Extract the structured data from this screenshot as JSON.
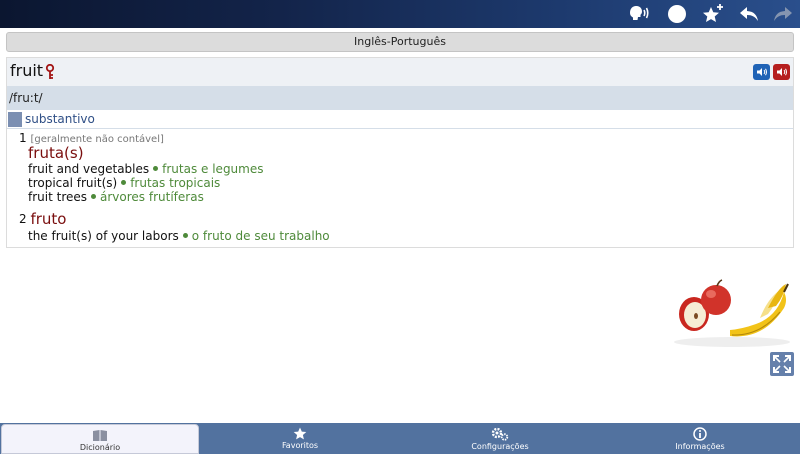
{
  "topbar": {
    "icons": [
      "speak-icon",
      "circle-icon",
      "star-plus-icon",
      "back-arrow-icon",
      "forward-arrow-icon"
    ]
  },
  "language_pair": "Inglês-Português",
  "entry": {
    "headword": "fruit",
    "pronunciation": "/fru:t/",
    "part_of_speech": "substantivo",
    "senses": [
      {
        "number": "1",
        "grammar": "[geralmente não contável]",
        "translation": "fruta(s)",
        "examples": [
          {
            "en": "fruit and vegetables",
            "pt": "frutas e legumes"
          },
          {
            "en": "tropical fruit(s)",
            "pt": "frutas tropicais"
          },
          {
            "en": "fruit trees",
            "pt": "árvores frutíferas"
          }
        ]
      },
      {
        "number": "2",
        "translation": "fruto",
        "examples": [
          {
            "en": "the fruit(s) of your labors",
            "pt": "o fruto de seu trabalho"
          }
        ]
      }
    ]
  },
  "colors": {
    "translation": "#7a0e0e",
    "example_translation": "#4e8a3a",
    "pos_label": "#2f4f86",
    "sound_uk": "#1f63b6",
    "sound_us": "#b61f1f",
    "bottom_bar": "#52729f"
  },
  "bottom_tabs": [
    {
      "label": "Dicionário",
      "icon": "book-icon",
      "active": true
    },
    {
      "label": "Favoritos",
      "icon": "star-icon",
      "active": false
    },
    {
      "label": "Configurações",
      "icon": "gears-icon",
      "active": false
    },
    {
      "label": "Informações",
      "icon": "info-icon",
      "active": false
    }
  ]
}
